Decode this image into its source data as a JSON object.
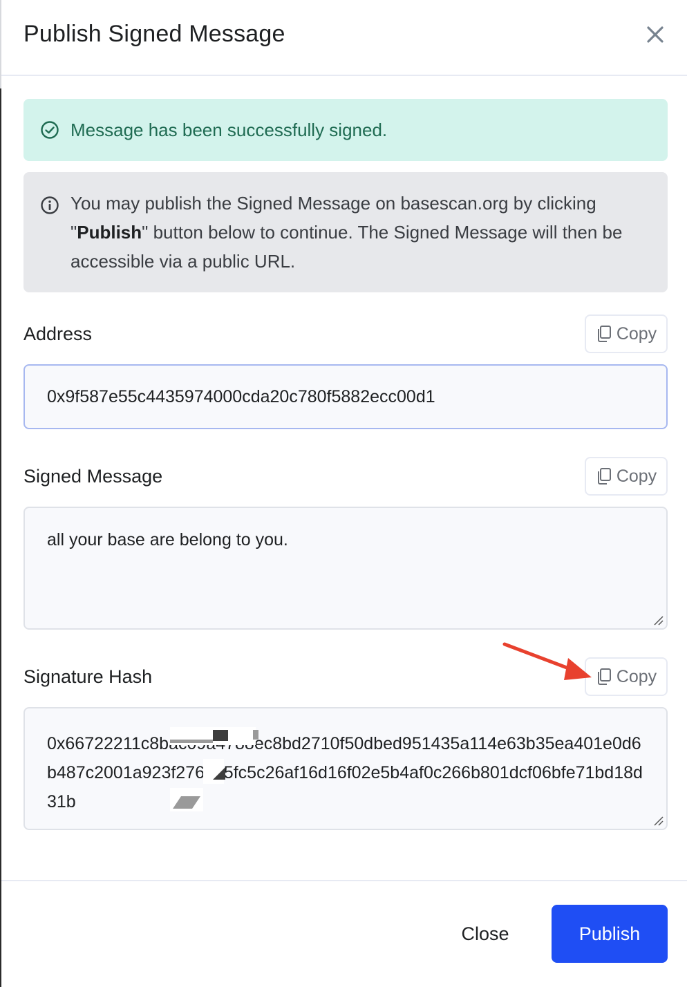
{
  "modal": {
    "title": "Publish Signed Message",
    "close_icon": "close-x-icon"
  },
  "alerts": {
    "success": {
      "icon": "check-circle-icon",
      "text": "Message has been successfully signed."
    },
    "info": {
      "icon": "info-circle-icon",
      "text_before": "You may publish the Signed Message on basescan.org by clicking \"",
      "bold": "Publish",
      "text_after": "\" button below to continue. The Signed Message will then be accessible via a public URL."
    }
  },
  "fields": {
    "address": {
      "label": "Address",
      "copy_label": "Copy",
      "value": "0x9f587e55c4435974000cda20c780f5882ecc00d1"
    },
    "signed_message": {
      "label": "Signed Message",
      "copy_label": "Copy",
      "value": "all your base are belong to you."
    },
    "signature_hash": {
      "label": "Signature Hash",
      "copy_label": "Copy",
      "value": "0x66722211c8bac09a4788ec8bd2710f50dbed951435a114e63b35ea401e0d6b487c2001a923f276625fc5c26af16d16f02e5b4af0c266b801dcf06bfe71bd18d31b"
    }
  },
  "footer": {
    "close_label": "Close",
    "publish_label": "Publish"
  },
  "colors": {
    "primary": "#1f4ef4",
    "success_bg": "#d3f3ec",
    "success_text": "#1f6b52",
    "info_bg": "#e7e8eb",
    "annotation_arrow": "#e8412e"
  }
}
